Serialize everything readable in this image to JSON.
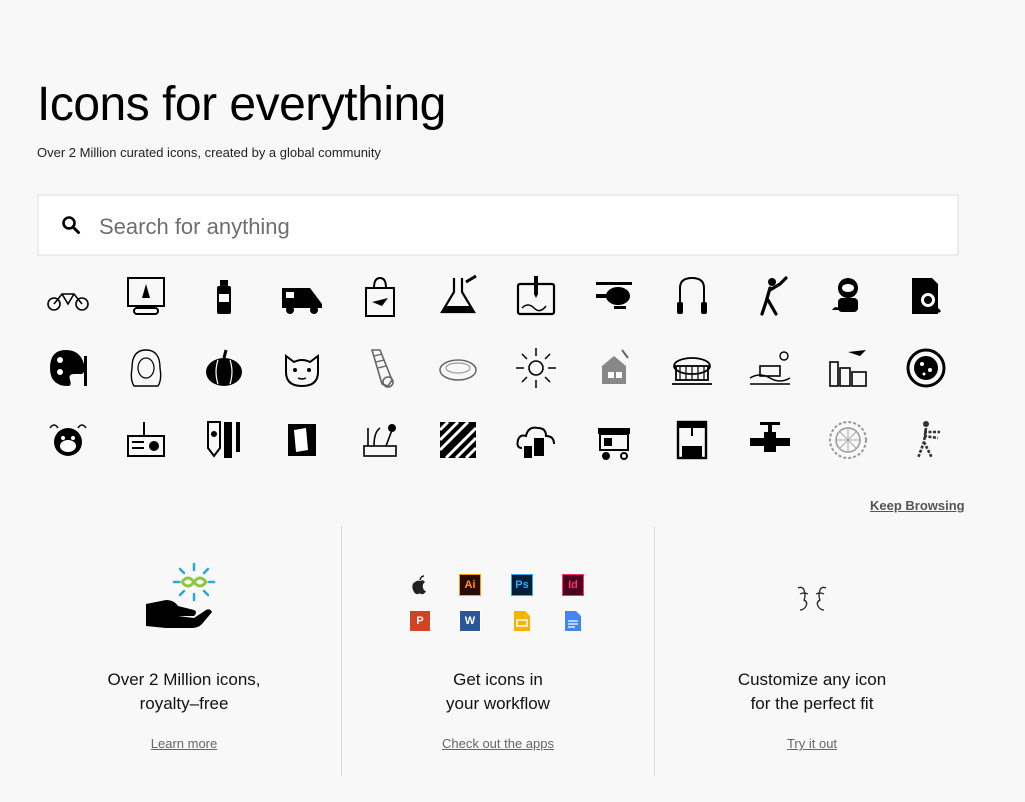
{
  "hero": {
    "title": "Icons for everything",
    "subtitle": "Over 2 Million curated icons, created by a global community"
  },
  "search": {
    "placeholder": "Search for anything",
    "icon": "search-icon"
  },
  "icon_grid": {
    "rows": [
      [
        "tandem-bicycle-icon",
        "arcade-game-icon",
        "spray-can-icon",
        "airport-stairs-truck-icon",
        "shopping-bag-plane-icon",
        "lab-flask-icon",
        "tablet-pen-icon",
        "helicopter-icon",
        "jump-rope-icon",
        "cricket-player-icon",
        "astronaut-icon",
        "document-search-icon"
      ],
      [
        "paint-palette-icon",
        "woman-portrait-icon",
        "pumpkin-icon",
        "cat-face-icon",
        "screw-icon",
        "soap-bar-icon",
        "sun-rays-icon",
        "house-blocks-icon",
        "stadium-icon",
        "camper-landscape-icon",
        "city-airplane-icon",
        "petri-dish-icon"
      ],
      [
        "monkey-face-icon",
        "radio-device-icon",
        "art-supplies-icon",
        "paper-note-icon",
        "gardening-icon",
        "zebra-crossing-icon",
        "cloud-devices-icon",
        "food-cart-icon",
        "arcade-claw-machine-icon",
        "pipe-valve-icon",
        "circular-pattern-icon",
        "zombie-walking-icon"
      ]
    ]
  },
  "keep_browsing": "Keep Browsing",
  "features": [
    {
      "title_line1": "Over 2 Million icons,",
      "title_line2": "royalty–free",
      "link": "Learn more",
      "icon": "hand-infinity-icon"
    },
    {
      "title_line1": "Get icons in",
      "title_line2": "your workflow",
      "link": "Check out the apps",
      "icon": "app-logos"
    },
    {
      "title_line1": "Customize any icon",
      "title_line2": "for the perfect fit",
      "link": "Try it out",
      "icon": "face-outline-icon"
    }
  ],
  "apps": [
    {
      "name": "apple-icon",
      "label": "",
      "color": "#222222"
    },
    {
      "name": "illustrator-icon",
      "label": "Ai",
      "color": "#ff9a00",
      "bg": "#2b0a00"
    },
    {
      "name": "photoshop-icon",
      "label": "Ps",
      "color": "#31a8ff",
      "bg": "#001e36"
    },
    {
      "name": "indesign-icon",
      "label": "Id",
      "color": "#ff3366",
      "bg": "#49021f"
    },
    {
      "name": "powerpoint-icon",
      "label": "P",
      "color": "#ffffff",
      "bg": "#d04423"
    },
    {
      "name": "word-icon",
      "label": "W",
      "color": "#ffffff",
      "bg": "#2b579a"
    },
    {
      "name": "google-slides-icon",
      "label": "",
      "color": "#f4b400"
    },
    {
      "name": "google-docs-icon",
      "label": "",
      "color": "#4285f4"
    }
  ],
  "colors": {
    "background": "#f8f8f8",
    "accent_blue": "#29a8e0",
    "accent_green": "#8dc63f"
  }
}
